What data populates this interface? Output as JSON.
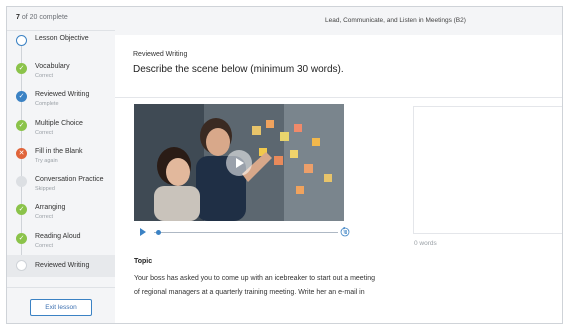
{
  "sidebar": {
    "progress": {
      "current": "7",
      "rest": "of 20 complete"
    },
    "steps": [
      {
        "name": "Lesson Objective",
        "status": "",
        "state": "open"
      },
      {
        "name": "Vocabulary",
        "status": "Correct",
        "state": "correct"
      },
      {
        "name": "Reviewed Writing",
        "status": "Complete",
        "state": "complete"
      },
      {
        "name": "Multiple Choice",
        "status": "Correct",
        "state": "correct"
      },
      {
        "name": "Fill in the Blank",
        "status": "Try again",
        "state": "tryagain"
      },
      {
        "name": "Conversation Practice",
        "status": "Skipped",
        "state": "skipped"
      },
      {
        "name": "Arranging",
        "status": "Correct",
        "state": "correct"
      },
      {
        "name": "Reading Aloud",
        "status": "Correct",
        "state": "correct"
      },
      {
        "name": "Reviewed Writing",
        "status": "",
        "state": "current"
      }
    ],
    "exit_label": "Exit lesson"
  },
  "header": {
    "lesson_title": "Lead, Communicate, and Listen in Meetings (B2)"
  },
  "main": {
    "kicker": "Reviewed Writing",
    "prompt": "Describe the scene below (minimum 30 words).",
    "video": {
      "progress": 0.02
    },
    "topic": {
      "label": "Topic",
      "lines": [
        "Your boss has asked you to come up with an icebreaker to start out a meeting",
        "of regional managers at a quarterly training meeting. Write her an e-mail in"
      ]
    },
    "answer": {
      "word_count": "0 words"
    }
  },
  "colors": {
    "accent": "#3b82c4",
    "correct": "#8bc34a",
    "try_again": "#e0643a",
    "skipped": "#dcdfe3"
  },
  "icons": {
    "correct": "check-icon",
    "try_again": "x-icon",
    "video": "play-icon",
    "replay": "replay-10-icon"
  }
}
